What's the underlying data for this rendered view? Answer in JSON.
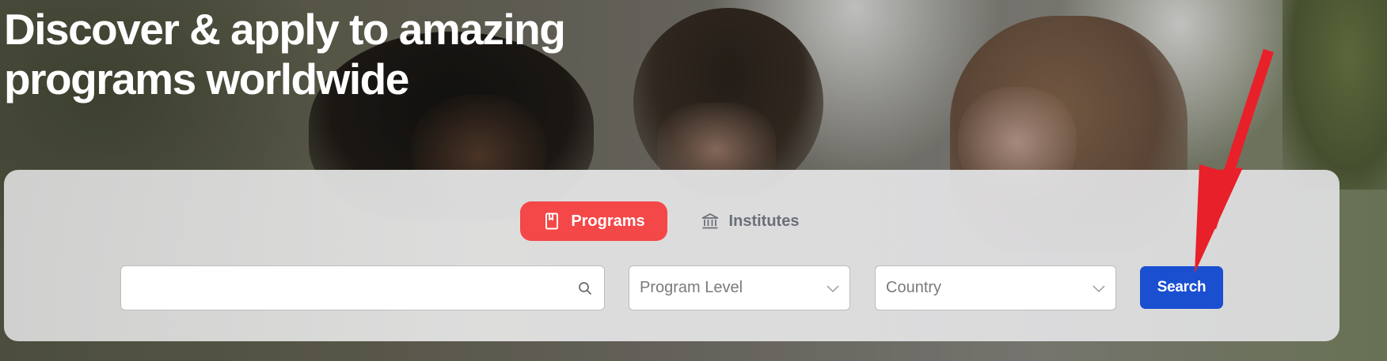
{
  "hero": {
    "headline_line1": "Discover & apply to amazing",
    "headline_line2": "programs worldwide"
  },
  "tabs": [
    {
      "label": "Programs",
      "icon": "book-icon",
      "active": true
    },
    {
      "label": "Institutes",
      "icon": "institution-icon",
      "active": false
    }
  ],
  "search": {
    "value": "",
    "placeholder": "",
    "icon": "search-icon"
  },
  "filters": {
    "program_level": {
      "label": "Program Level",
      "icon": "chevron-down-icon"
    },
    "country": {
      "label": "Country",
      "icon": "chevron-down-icon"
    }
  },
  "search_button": {
    "label": "Search"
  },
  "annotation": {
    "type": "arrow",
    "target": "search-button",
    "color": "#e8202a"
  },
  "colors": {
    "accent_red": "#f44748",
    "primary_blue": "#1a4fd0",
    "muted_text": "#6b6f78",
    "headline_text": "#ffffff"
  }
}
